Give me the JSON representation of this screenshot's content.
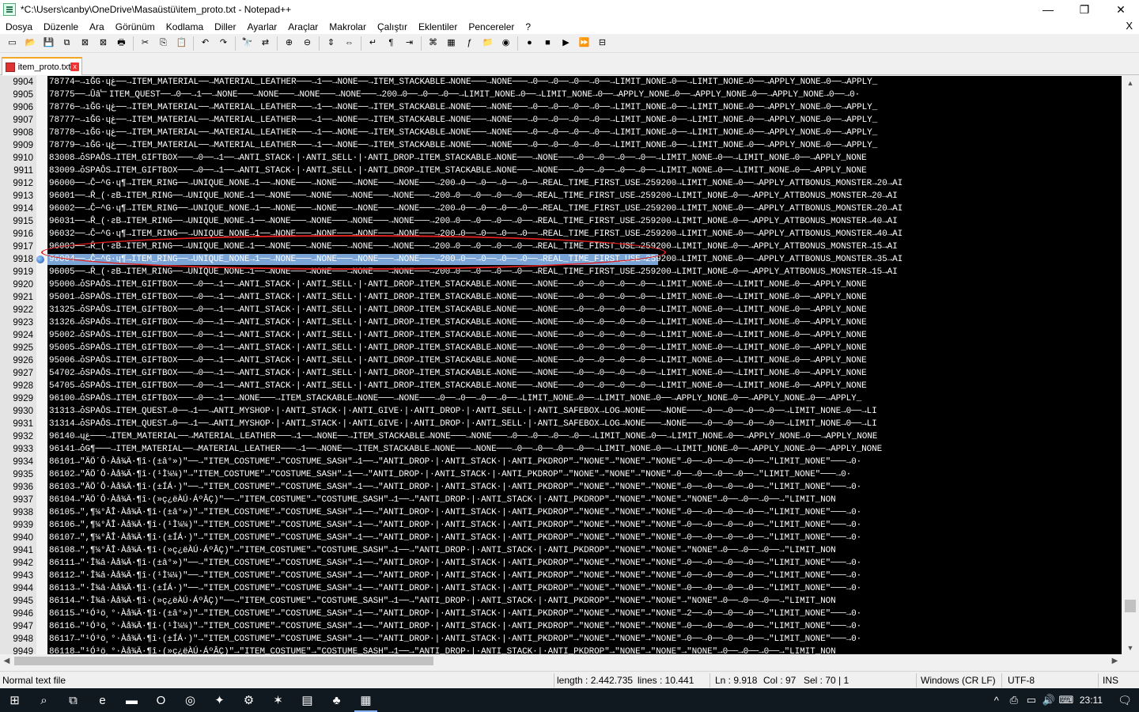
{
  "window": {
    "title": "*C:\\Users\\canby\\OneDrive\\Masaüstü\\item_proto.txt - Notepad++",
    "minimize": "—",
    "maximize": "❐",
    "close": "✕"
  },
  "menu": {
    "items": [
      "Dosya",
      "Düzenle",
      "Ara",
      "Görünüm",
      "Kodlama",
      "Diller",
      "Ayarlar",
      "Araçlar",
      "Makrolar",
      "Çalıştır",
      "Eklentiler",
      "Pencereler",
      "?"
    ],
    "close": "X"
  },
  "toolbar": {
    "icons": [
      "new-file-icon",
      "open-file-icon",
      "save-icon",
      "save-all-icon",
      "close-icon",
      "close-all-icon",
      "print-icon",
      "cut-icon",
      "copy-icon",
      "paste-icon",
      "undo-icon",
      "redo-icon",
      "find-icon",
      "replace-icon",
      "zoom-in-icon",
      "zoom-out-icon",
      "sync-vertical-icon",
      "sync-horizontal-icon",
      "word-wrap-icon",
      "show-all-chars-icon",
      "indent-guide-icon",
      "language-icon",
      "doc-map-icon",
      "function-list-icon",
      "folder-workspace-icon",
      "monitoring-icon",
      "record-macro-icon",
      "stop-macro-icon",
      "play-macro-icon",
      "run-macro-multiple-icon",
      "save-macro-icon"
    ],
    "glyphs": [
      "▭",
      "📂",
      "💾",
      "⧉",
      "⊠",
      "⊠",
      "🖶",
      "✂",
      "⎘",
      "📋",
      "↶",
      "↷",
      "🔭",
      "⇄",
      "⊕",
      "⊖",
      "⇕",
      "⇔",
      "↵",
      "¶",
      "⇥",
      "⌘",
      "▦",
      "ƒ",
      "📁",
      "◉",
      "●",
      "■",
      "▶",
      "⏩",
      "⊟"
    ]
  },
  "tab": {
    "label": "item_proto.txt",
    "close": "x"
  },
  "editor": {
    "selected_line": "9918",
    "lines": [
      {
        "n": "9904",
        "t": "78774─→ıĞG·ɥغ──→ITEM_MATERIAL──→MATERIAL_LEATHER───→1──→NONE──→ITEM_STACKABLE→NONE───→NONE───→0──→0──→0──→0──→LIMIT_NONE→0──→LIMIT_NONE→0──→APPLY_NONE→0──→APPLY_"
      },
      {
        "n": "9905",
        "t": "78775──→Ûâ﹂ITEM_QUEST──→0──→1──→NONE───→NONE───→NONE───→NONE───→200→0──→0──→0──→LIMIT_NONE→0──→LIMIT_NONE→0──→APPLY_NONE→0──→APPLY_NONE→0──→APPLY_NONE→0──→0·"
      },
      {
        "n": "9906",
        "t": "78776─→ıĞG·ɥغ──→ITEM_MATERIAL──→MATERIAL_LEATHER───→1──→NONE──→ITEM_STACKABLE→NONE───→NONE───→0──→0──→0──→0──→LIMIT_NONE→0──→LIMIT_NONE→0──→APPLY_NONE→0──→APPLY_"
      },
      {
        "n": "9907",
        "t": "78777─→ıĞG·ɥغ──→ITEM_MATERIAL──→MATERIAL_LEATHER───→1──→NONE──→ITEM_STACKABLE→NONE───→NONE───→0──→0──→0──→0──→LIMIT_NONE→0──→LIMIT_NONE→0──→APPLY_NONE→0──→APPLY_"
      },
      {
        "n": "9908",
        "t": "78778─→ıĞG·ɥغ──→ITEM_MATERIAL──→MATERIAL_LEATHER───→1──→NONE──→ITEM_STACKABLE→NONE───→NONE───→0──→0──→0──→0──→LIMIT_NONE→0──→LIMIT_NONE→0──→APPLY_NONE→0──→APPLY_"
      },
      {
        "n": "9909",
        "t": "78779─→ıĞG·ɥغ──→ITEM_MATERIAL──→MATERIAL_LEATHER───→1──→NONE──→ITEM_STACKABLE→NONE───→NONE───→0──→0──→0──→0──→LIMIT_NONE→0──→LIMIT_NONE→0──→APPLY_NONE→0──→APPLY_"
      },
      {
        "n": "9910",
        "t": "83008→ȱSPAÔS→ITEM_GIFTBOX───→0──→1──→ANTI_STACK·|·ANTI_SELL·|·ANTI_DROP→ITEM_STACKABLE→NONE───→NONE───→0──→0──→0──→0──→LIMIT_NONE→0──→LIMIT_NONE→0──→APPLY_NONE"
      },
      {
        "n": "9911",
        "t": "83009→ȱSPAÔS→ITEM_GIFTBOX───→0──→1──→ANTI_STACK·|·ANTI_SELL·|·ANTI_DROP→ITEM_STACKABLE→NONE───→NONE───→0──→0──→0──→0──→LIMIT_NONE→0──→LIMIT_NONE→0──→APPLY_NONE"
      },
      {
        "n": "9912",
        "t": "96000──→Ĉ─^G·ɥ¶→ITEM_RING──→UNIQUE_NONE→1──→NONE───→NONE───→NONE───→NONE───→200→0──→0──→0──→0──→REAL_TIME_FIRST_USE→259200→LIMIT_NONE→0──→APPLY_ATTBONUS_MONSTER→20→AI"
      },
      {
        "n": "9913",
        "t": "96001──→Ȓ_(·ƨB→ITEM_RING──→UNIQUE_NONE→1──→NONE───→NONE───→NONE───→NONE───→200→0──→0──→0──→0──→REAL_TIME_FIRST_USE→259200→LIMIT_NONE→0──→APPLY_ATTBONUS_MONSTER→20→AI"
      },
      {
        "n": "9914",
        "t": "96002──→Ĉ─^G·ɥ¶→ITEM_RING──→UNIQUE_NONE→1──→NONE───→NONE───→NONE───→NONE───→200→0──→0──→0──→0──→REAL_TIME_FIRST_USE→259200→LIMIT_NONE→0──→APPLY_ATTBONUS_MONSTER→20→AI"
      },
      {
        "n": "9915",
        "t": "96031──→Ȓ_(·ƨB→ITEM_RING──→UNIQUE_NONE→1──→NONE───→NONE───→NONE───→NONE───→200→0──→0──→0──→0──→REAL_TIME_FIRST_USE→259200→LIMIT_NONE→0──→APPLY_ATTBONUS_MONSTER→40→AI"
      },
      {
        "n": "9916",
        "t": "96032──→Ĉ─^G·ɥ¶→ITEM_RING──→UNIQUE_NONE→1──→NONE───→NONE───→NONE───→NONE───→200→0──→0──→0──→0──→REAL_TIME_FIRST_USE→259200→LIMIT_NONE→0──→APPLY_ATTBONUS_MONSTER→40→AI"
      },
      {
        "n": "9917",
        "t": "96003──→Ȓ_(·ƨB→ITEM_RING──→UNIQUE_NONE→1──→NONE───→NONE───→NONE───→NONE───→200→0──→0──→0──→0──→REAL_TIME_FIRST_USE→259200→LIMIT_NONE→0──→APPLY_ATTBONUS_MONSTER→15→AI"
      },
      {
        "n": "9918",
        "t": "96004──→Ĉ─^G·ɥ¶→ITEM_RING──→UNIQUE_NONE→1──→NONE───→NONE───→NONE───→NONE───→200→0──→0──→0──→0──→REAL_TIME_FIRST_USE→259200→LIMIT_NONE→0──→APPLY_ATTBONUS_MONSTER→35→AI"
      },
      {
        "n": "9919",
        "t": "96005──→Ȓ_(·ƨB→ITEM_RING──→UNIQUE_NONE→1──→NONE───→NONE───→NONE───→NONE───→200→0──→0──→0──→0──→REAL_TIME_FIRST_USE→259200→LIMIT_NONE→0──→APPLY_ATTBONUS_MONSTER→15→AI"
      },
      {
        "n": "9920",
        "t": "95000→ȱSPAÔS→ITEM_GIFTBOX───→0──→1──→ANTI_STACK·|·ANTI_SELL·|·ANTI_DROP→ITEM_STACKABLE→NONE───→NONE───→0──→0──→0──→0──→LIMIT_NONE→0──→LIMIT_NONE→0──→APPLY_NONE"
      },
      {
        "n": "9921",
        "t": "95001→ȱSPAÔS→ITEM_GIFTBOX───→0──→1──→ANTI_STACK·|·ANTI_SELL·|·ANTI_DROP→ITEM_STACKABLE→NONE───→NONE───→0──→0──→0──→0──→LIMIT_NONE→0──→LIMIT_NONE→0──→APPLY_NONE"
      },
      {
        "n": "9922",
        "t": "31325→ȱSPAÔS→ITEM_GIFTBOX───→0──→1──→ANTI_STACK·|·ANTI_SELL·|·ANTI_DROP→ITEM_STACKABLE→NONE───→NONE───→0──→0──→0──→0──→LIMIT_NONE→0──→LIMIT_NONE→0──→APPLY_NONE"
      },
      {
        "n": "9923",
        "t": "31326→ȱSPAÔS→ITEM_GIFTBOX───→0──→1──→ANTI_STACK·|·ANTI_SELL·|·ANTI_DROP→ITEM_STACKABLE→NONE───→NONE───→0──→0──→0──→0──→LIMIT_NONE→0──→LIMIT_NONE→0──→APPLY_NONE"
      },
      {
        "n": "9924",
        "t": "95002→ȱSPAÔS→ITEM_GIFTBOX───→0──→1──→ANTI_STACK·|·ANTI_SELL·|·ANTI_DROP→ITEM_STACKABLE→NONE───→NONE───→0──→0──→0──→0──→LIMIT_NONE→0──→LIMIT_NONE→0──→APPLY_NONE"
      },
      {
        "n": "9925",
        "t": "95005→ȱSPAÔS→ITEM_GIFTBOX───→0──→1──→ANTI_STACK·|·ANTI_SELL·|·ANTI_DROP→ITEM_STACKABLE→NONE───→NONE───→0──→0──→0──→0──→LIMIT_NONE→0──→LIMIT_NONE→0──→APPLY_NONE"
      },
      {
        "n": "9926",
        "t": "95006→ȱSPAÔS→ITEM_GIFTBOX───→0──→1──→ANTI_STACK·|·ANTI_SELL·|·ANTI_DROP→ITEM_STACKABLE→NONE───→NONE───→0──→0──→0──→0──→LIMIT_NONE→0──→LIMIT_NONE→0──→APPLY_NONE"
      },
      {
        "n": "9927",
        "t": "54702→ȱSPAÔS→ITEM_GIFTBOX───→0──→1──→ANTI_STACK·|·ANTI_SELL·|·ANTI_DROP→ITEM_STACKABLE→NONE───→NONE───→0──→0──→0──→0──→LIMIT_NONE→0──→LIMIT_NONE→0──→APPLY_NONE"
      },
      {
        "n": "9928",
        "t": "54705→ȱSPAÔS→ITEM_GIFTBOX───→0──→1──→ANTI_STACK·|·ANTI_SELL·|·ANTI_DROP→ITEM_STACKABLE→NONE───→NONE───→0──→0──→0──→0──→LIMIT_NONE→0──→LIMIT_NONE→0──→APPLY_NONE"
      },
      {
        "n": "9929",
        "t": "96100→ȱSPAÔS→ITEM_GIFTBOX───→0──→1──→NONE───→ITEM_STACKABLE→NONE───→NONE───→0──→0──→0──→0──→LIMIT_NONE→0──→LIMIT_NONE→0──→APPLY_NONE→0──→APPLY_NONE→0──→APPLY_"
      },
      {
        "n": "9930",
        "t": "31313→ȱSPAÔS→ITEM_QUEST→0──→1──→ANTI_MYSHOP·|·ANTI_STACK·|·ANTI_GIVE·|·ANTI_DROP·|·ANTI_SELL·|·ANTI_SAFEBOX→LOG→NONE───→NONE───→0──→0──→0──→0──→LIMIT_NONE→0──→LI"
      },
      {
        "n": "9931",
        "t": "31314→ȱSPAÔS→ITEM_QUEST→0──→1──→ANTI_MYSHOP·|·ANTI_STACK·|·ANTI_GIVE·|·ANTI_DROP·|·ANTI_SELL·|·ANTI_SAFEBOX→LOG→NONE───→NONE───→0──→0──→0──→0──→LIMIT_NONE→0──→LI"
      },
      {
        "n": "9932",
        "t": "96140→ɥغ───→ITEM_MATERIAL──→MATERIAL_LEATHER───→1──→NONE──→ITEM_STACKABLE→NONE───→NONE───→0──→0──→0──→0──→LIMIT_NONE→0──→LIMIT_NONE→0──→APPLY_NONE→0──→APPLY_NONE"
      },
      {
        "n": "9933",
        "t": "96141→ȱǤ¶───→ITEM_MATERIAL──→MATERIAL_LEATHER───→1──→NONE──→ITEM_STACKABLE→NONE───→NONE───→0──→0──→0──→0──→LIMIT_NONE→0──→LIMIT_NONE→0──→APPLY_NONE→0──→APPLY_NONE"
      },
      {
        "n": "9934",
        "t": "86101→\"ÄÖ´Ô·Àå¾Ä·¶î·(±â°»)\"──→\"ITEM_COSTUME\"→\"COSTUME_SASH\"→1──→\"ANTI_DROP·|·ANTI_STACK·|·ANTI_PKDROP\"→\"NONE\"→\"NONE\"→\"NONE\"→0──→0──→0──→0──→\"LIMIT_NONE\"───→0·"
      },
      {
        "n": "9935",
        "t": "86102→\"ÄÖ´Ô·Àå¾Ä·¶î·(¹Ì¼¼)\"→\"ITEM_COSTUME\"→\"COSTUME_SASH\"→1──→\"ANTI_DROP·|·ANTI_STACK·|·ANTI_PKDROP\"→\"NONE\"→\"NONE\"→\"NONE\"→0──→0──→0──→0──→\"LIMIT_NONE\"───→0·"
      },
      {
        "n": "9936",
        "t": "86103→\"ÄÖ´Ô·Àå¾Ä·¶î·(±ÍÁ·)\"──→\"ITEM_COSTUME\"→\"COSTUME_SASH\"→1──→\"ANTI_DROP·|·ANTI_STACK·|·ANTI_PKDROP\"→\"NONE\"→\"NONE\"→\"NONE\"→0──→0──→0──→0──→\"LIMIT_NONE\"───→0·"
      },
      {
        "n": "9937",
        "t": "86104→\"ÄÖ´Ô·Àå¾Ä·¶î·(»ç¿ëÀÚ·ÁºÂÇ)\"──→\"ITEM_COSTUME\"→\"COSTUME_SASH\"→1──→\"ANTI_DROP·|·ANTI_STACK·|·ANTI_PKDROP\"→\"NONE\"→\"NONE\"→\"NONE\"→0──→0──→0──→\"LIMIT_NON"
      },
      {
        "n": "9938",
        "t": "86105→\",¶¼°ÂÎ·Àå¾Ä·¶î·(±â°»)\"→\"ITEM_COSTUME\"→\"COSTUME_SASH\"→1──→\"ANTI_DROP·|·ANTI_STACK·|·ANTI_PKDROP\"→\"NONE\"→\"NONE\"→\"NONE\"→0──→0──→0──→0──→\"LIMIT_NONE\"───→0·"
      },
      {
        "n": "9939",
        "t": "86106→\",¶¼°ÂÎ·Àå¾Ä·¶î·(¹Ì¼¼)\"→\"ITEM_COSTUME\"→\"COSTUME_SASH\"→1──→\"ANTI_DROP·|·ANTI_STACK·|·ANTI_PKDROP\"→\"NONE\"→\"NONE\"→\"NONE\"→0──→0──→0──→0──→\"LIMIT_NONE\"───→0·"
      },
      {
        "n": "9940",
        "t": "86107→\",¶¼°ÂÎ·Àå¾Ä·¶î·(±ÍÁ·)\"→\"ITEM_COSTUME\"→\"COSTUME_SASH\"→1──→\"ANTI_DROP·|·ANTI_STACK·|·ANTI_PKDROP\"→\"NONE\"→\"NONE\"→\"NONE\"→0──→0──→0──→0──→\"LIMIT_NONE\"───→0·"
      },
      {
        "n": "9941",
        "t": "86108→\",¶¼°ÂÎ·Àå¾Ä·¶î·(»ç¿ëÀÚ·ÁºÂÇ)\"→\"ITEM_COSTUME\"→\"COSTUME_SASH\"→1──→\"ANTI_DROP·|·ANTI_STACK·|·ANTI_PKDROP\"→\"NONE\"→\"NONE\"→\"NONE\"→0──→0──→0──→\"LIMIT_NON"
      },
      {
        "n": "9942",
        "t": "86111→\"·Î¾â·Àå¾Ä·¶î·(±â°»)\"──→\"ITEM_COSTUME\"→\"COSTUME_SASH\"→1──→\"ANTI_DROP·|·ANTI_STACK·|·ANTI_PKDROP\"→\"NONE\"→\"NONE\"→\"NONE\"→0──→0──→0──→0──→\"LIMIT_NONE\"───→0·"
      },
      {
        "n": "9943",
        "t": "86112→\"·Î¾â·Àå¾Ä·¶î·(¹Ì¼¼)\"──→\"ITEM_COSTUME\"→\"COSTUME_SASH\"→1──→\"ANTI_DROP·|·ANTI_STACK·|·ANTI_PKDROP\"→\"NONE\"→\"NONE\"→\"NONE\"→0──→0──→0──→0──→\"LIMIT_NONE\"───→0·"
      },
      {
        "n": "9944",
        "t": "86113→\"·Î¾â·Àå¾Ä·¶î·(±ÍÁ·)\"──→\"ITEM_COSTUME\"→\"COSTUME_SASH\"→1──→\"ANTI_DROP·|·ANTI_STACK·|·ANTI_PKDROP\"→\"NONE\"→\"NONE\"→\"NONE\"→0──→0──→0──→0──→\"LIMIT_NONE\"───→0·"
      },
      {
        "n": "9945",
        "t": "86114→\"·Î¾â·Àå¾Ä·¶î·(»ç¿ëÀÚ·ÁºÂÇ)\"──→\"ITEM_COSTUME\"→\"COSTUME_SASH\"→1──→\"ANTI_DROP·|·ANTI_STACK·|·ANTI_PKDROP\"→\"NONE\"→\"NONE\"→\"NONE\"→0──→0──→0──→\"LIMIT_NON"
      },
      {
        "n": "9946",
        "t": "86115→\"¹Ó³ö¸°·Àå¾Ä·¶î·(±â°»)\"→\"ITEM_COSTUME\"→\"COSTUME_SASH\"→1──→\"ANTI_DROP·|·ANTI_STACK·|·ANTI_PKDROP\"→\"NONE\"→\"NONE\"→\"NONE\"→2──→0──→0──→0──→\"LIMIT_NONE\"───→0·"
      },
      {
        "n": "9947",
        "t": "86116→\"¹Ó³ö¸°·Àå¾Ä·¶î·(¹Ì¼¼)\"→\"ITEM_COSTUME\"→\"COSTUME_SASH\"→1──→\"ANTI_DROP·|·ANTI_STACK·|·ANTI_PKDROP\"→\"NONE\"→\"NONE\"→\"NONE\"→0──→0──→0──→0──→\"LIMIT_NONE\"───→0·"
      },
      {
        "n": "9948",
        "t": "86117→\"¹Ó³ö¸°·Àå¾Ä·¶î·(±ÍÁ·)\"→\"ITEM_COSTUME\"→\"COSTUME_SASH\"→1──→\"ANTI_DROP·|·ANTI_STACK·|·ANTI_PKDROP\"→\"NONE\"→\"NONE\"→\"NONE\"→0──→0──→0──→0──→\"LIMIT_NONE\"───→0·"
      },
      {
        "n": "9949",
        "t": "86118→\"¹Ó³ö¸°·Àå¾Ä·¶î·(»ç¿ëÀÚ·ÁºÂÇ)\"→\"ITEM_COSTUME\"→\"COSTUME_SASH\"→1──→\"ANTI_DROP·|·ANTI_STACK·|·ANTI_PKDROP\"→\"NONE\"→\"NONE\"→\"NONE\"→0──→0──→0──→\"LIMIT_NON"
      }
    ]
  },
  "status": {
    "file_type": "Normal text file",
    "length": "length : 2.442.735",
    "lines": "lines : 10.441",
    "ln": "Ln : 9.918",
    "col": "Col : 97",
    "sel": "Sel : 70 | 1",
    "eol": "Windows (CR LF)",
    "encoding": "UTF-8",
    "mode": "INS"
  },
  "taskbar": {
    "apps": [
      {
        "name": "start-button",
        "glyph": "⊞"
      },
      {
        "name": "search-icon",
        "glyph": "⌕"
      },
      {
        "name": "task-view-icon",
        "glyph": "⧉"
      },
      {
        "name": "edge-icon",
        "glyph": "e"
      },
      {
        "name": "file-explorer-icon",
        "glyph": "▬"
      },
      {
        "name": "opera-icon",
        "glyph": "O"
      },
      {
        "name": "opera-gx-icon",
        "glyph": "◎"
      },
      {
        "name": "app-icon-1",
        "glyph": "✦"
      },
      {
        "name": "app-icon-2",
        "glyph": "⚙"
      },
      {
        "name": "app-icon-3",
        "glyph": "✶"
      },
      {
        "name": "app-icon-4",
        "glyph": "▤"
      },
      {
        "name": "app-icon-5",
        "glyph": "♣"
      },
      {
        "name": "notepad-plus-plus-icon",
        "glyph": "▦"
      }
    ],
    "tray": [
      "^",
      "⎙",
      "▭",
      "🔊",
      "⌨"
    ],
    "clock": "23:11",
    "notification": "🗨"
  },
  "colors": {
    "editor_bg": "#000000",
    "selection": "#7aa4d6",
    "annotation": "#e02020",
    "tab_accent": "#f5a623"
  }
}
